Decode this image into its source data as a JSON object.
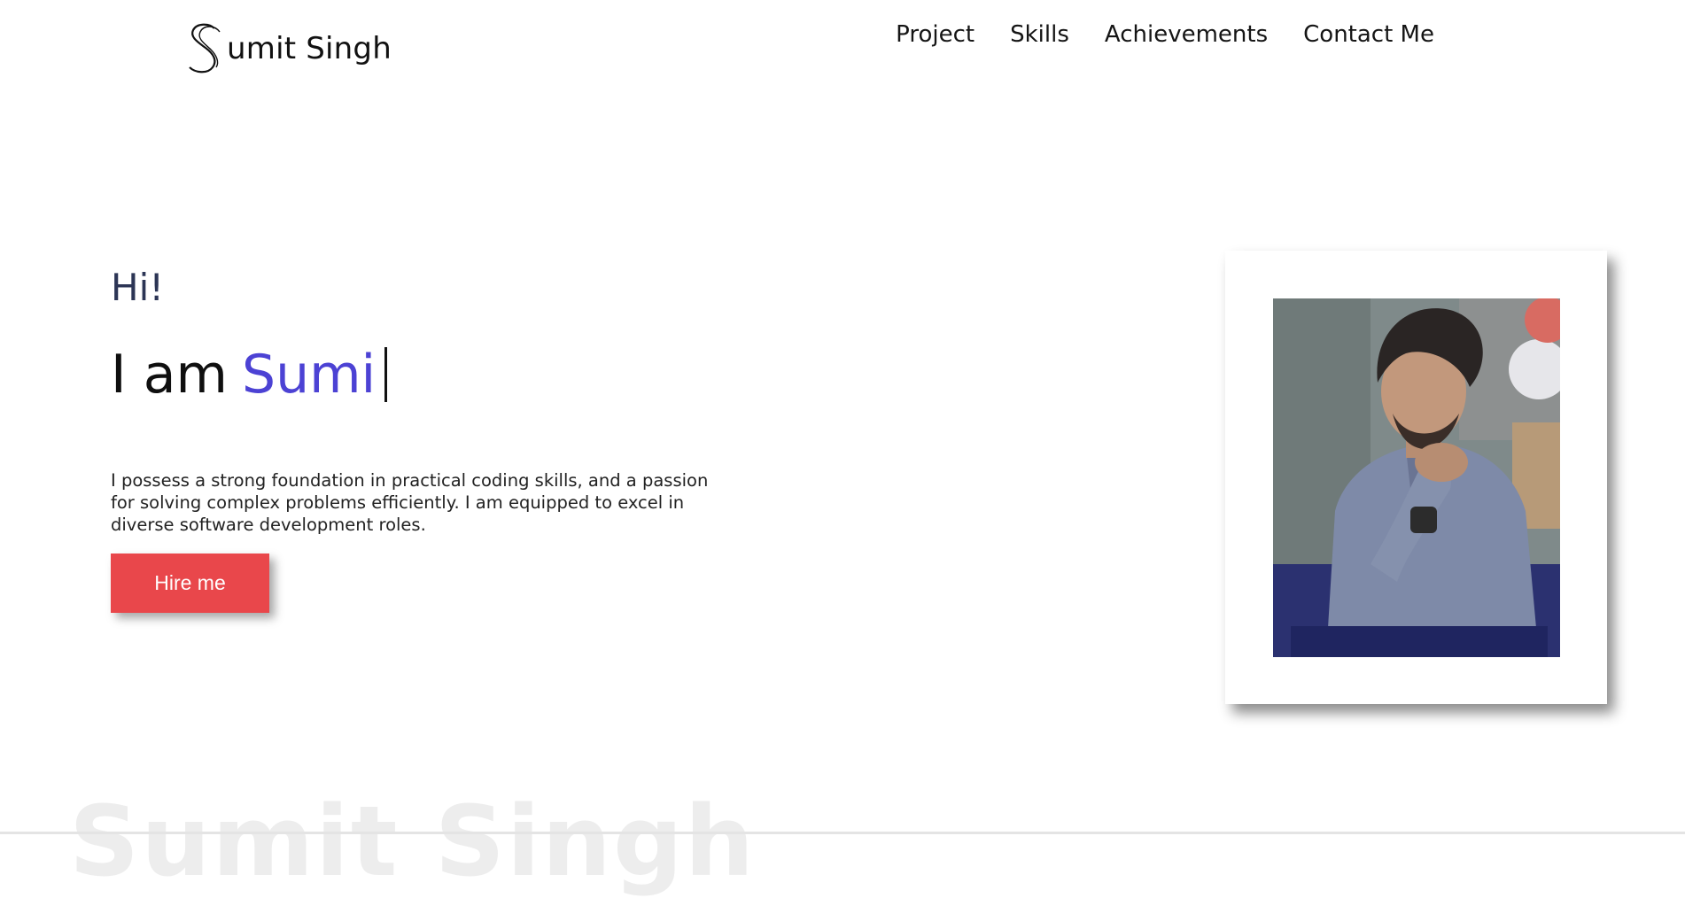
{
  "brand": {
    "name": "Sumit Singh",
    "logo_text": "umit Singh"
  },
  "nav": {
    "items": [
      {
        "label": "Project"
      },
      {
        "label": "Skills"
      },
      {
        "label": "Achievements"
      },
      {
        "label": "Contact Me"
      }
    ]
  },
  "hero": {
    "greeting": "Hi!",
    "intro_prefix": "I am",
    "typed_name": "Sumi",
    "description": "I possess a strong foundation in practical coding skills, and a passion for solving complex problems efficiently. I am equipped to excel in diverse software development roles.",
    "cta_label": "Hire me"
  },
  "watermark": {
    "text": "Sumit Singh"
  },
  "colors": {
    "accent": "#4c42d4",
    "cta": "#e9474b",
    "greeting": "#2c3555"
  }
}
